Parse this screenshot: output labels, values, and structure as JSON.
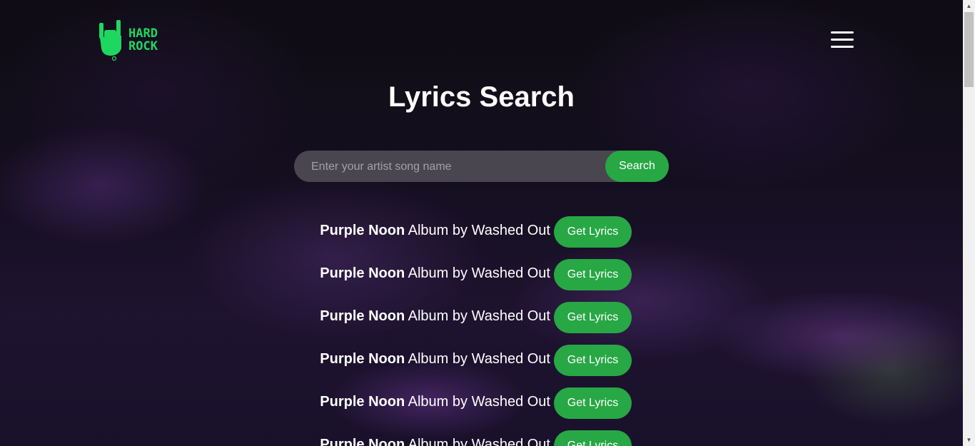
{
  "header": {
    "logo_line1": "HARD",
    "logo_line2": "ROCK",
    "menu_icon": "hamburger-menu-icon"
  },
  "title": "Lyrics Search",
  "search": {
    "placeholder": "Enter your artist song name",
    "value": "",
    "button_label": "Search"
  },
  "results": [
    {
      "song": "Purple Noon",
      "info": " Album by Washed Out",
      "button": "Get Lyrics"
    },
    {
      "song": "Purple Noon",
      "info": " Album by Washed Out",
      "button": "Get Lyrics"
    },
    {
      "song": "Purple Noon",
      "info": " Album by Washed Out",
      "button": "Get Lyrics"
    },
    {
      "song": "Purple Noon",
      "info": " Album by Washed Out",
      "button": "Get Lyrics"
    },
    {
      "song": "Purple Noon",
      "info": " Album by Washed Out",
      "button": "Get Lyrics"
    },
    {
      "song": "Purple Noon",
      "info": " Album by Washed Out",
      "button": "Get Lyrics"
    }
  ],
  "colors": {
    "accent": "#28a745",
    "logo": "#1ed760",
    "search_bg": "#4a4650"
  }
}
